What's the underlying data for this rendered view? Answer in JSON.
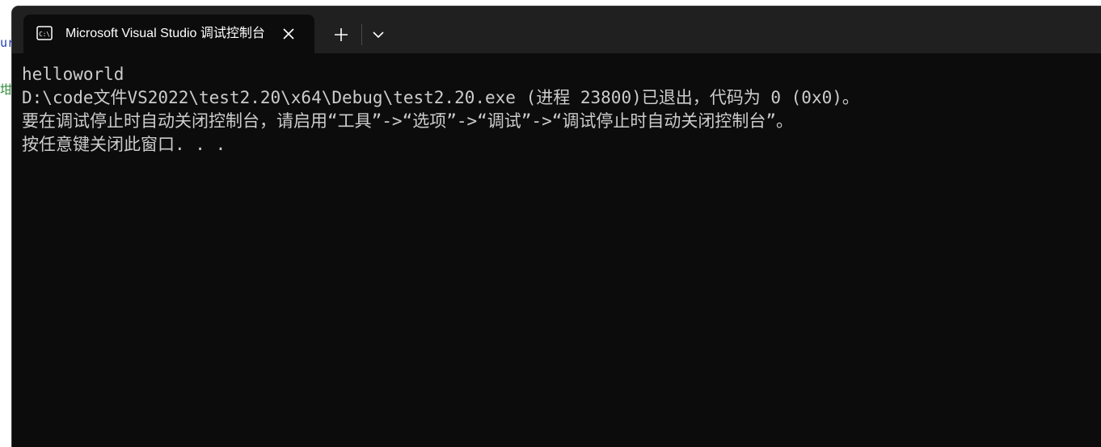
{
  "background_editor": {
    "fragment_1": "ur",
    "fragment_2": "坩"
  },
  "tab": {
    "title": "Microsoft Visual Studio 调试控制台",
    "icon": "terminal-icon"
  },
  "tabbar": {
    "close_icon": "close-icon",
    "new_tab_icon": "plus-icon",
    "dropdown_icon": "chevron-down-icon"
  },
  "console": {
    "lines": [
      "helloworld",
      "D:\\code文件VS2022\\test2.20\\x64\\Debug\\test2.20.exe (进程 23800)已退出，代码为 0 (0x0)。",
      "要在调试停止时自动关闭控制台，请启用“工具”->“选项”->“调试”->“调试停止时自动关闭控制台”。",
      "按任意键关闭此窗口. . ."
    ]
  },
  "colors": {
    "console_background": "#0c0c0c",
    "tabbar_background": "#202020",
    "console_text": "#cccccc",
    "tab_text": "#ffffff"
  }
}
